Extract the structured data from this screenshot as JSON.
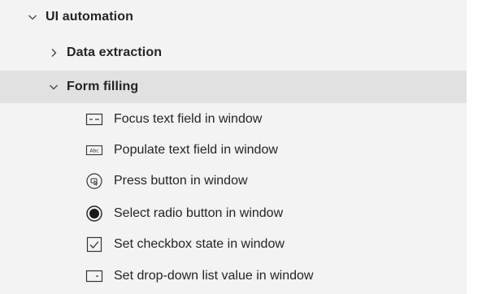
{
  "tree": {
    "root": {
      "label": "UI automation",
      "expanded": true,
      "icon": "chevron-down-icon"
    },
    "groups": [
      {
        "label": "Data extraction",
        "expanded": false,
        "icon": "chevron-right-icon"
      },
      {
        "label": "Form filling",
        "expanded": true,
        "selected": true,
        "icon": "chevron-down-icon"
      }
    ],
    "actions": [
      {
        "label": "Focus text field in window",
        "icon": "text-field-focus-icon"
      },
      {
        "label": "Populate text field in window",
        "icon": "abc-text-field-icon"
      },
      {
        "label": "Press button in window",
        "icon": "press-button-icon"
      },
      {
        "label": "Select radio button in window",
        "icon": "radio-button-icon"
      },
      {
        "label": "Set checkbox state in window",
        "icon": "checkbox-checked-icon"
      },
      {
        "label": "Set drop-down list value in window",
        "icon": "dropdown-list-icon"
      }
    ]
  },
  "colors": {
    "background": "#f3f3f3",
    "selected_row": "#e1e1e1",
    "text": "#242424"
  }
}
